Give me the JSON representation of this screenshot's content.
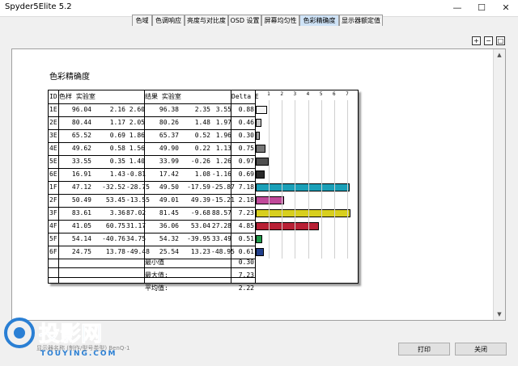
{
  "window": {
    "title": "Spyder5Elite 5.2",
    "minimize": "—",
    "maximize": "☐",
    "close": "✕"
  },
  "tabs": [
    {
      "label": "色域",
      "active": false
    },
    {
      "label": "色调响应",
      "active": false
    },
    {
      "label": "亮度与对比度",
      "active": false
    },
    {
      "label": "OSD 设置",
      "active": false
    },
    {
      "label": "屏幕均匀性",
      "active": false
    },
    {
      "label": "色彩精确度",
      "active": true
    },
    {
      "label": "显示器额定值",
      "active": false
    }
  ],
  "report": {
    "title": "色彩精确度",
    "headers": {
      "id": "ID",
      "sample": "色样 实验室",
      "result": "结果 实验室",
      "delta": "Delta E"
    },
    "rows": [
      {
        "id": "1E",
        "s": [
          "96.04",
          "2.16",
          "2.60"
        ],
        "r": [
          "96.38",
          "2.35",
          "3.55"
        ],
        "de": "0.88",
        "color": "#f4f4f4"
      },
      {
        "id": "2E",
        "s": [
          "80.44",
          "1.17",
          "2.05"
        ],
        "r": [
          "80.26",
          "1.48",
          "1.97"
        ],
        "de": "0.46",
        "color": "#c8c8c8"
      },
      {
        "id": "3E",
        "s": [
          "65.52",
          "0.69",
          "1.86"
        ],
        "r": [
          "65.37",
          "0.52",
          "1.96"
        ],
        "de": "0.30",
        "color": "#a0a0a0"
      },
      {
        "id": "4E",
        "s": [
          "49.62",
          "0.58",
          "1.56"
        ],
        "r": [
          "49.90",
          "0.22",
          "1.13"
        ],
        "de": "0.75",
        "color": "#777777"
      },
      {
        "id": "5E",
        "s": [
          "33.55",
          "0.35",
          "1.40"
        ],
        "r": [
          "33.99",
          "-0.26",
          "1.26"
        ],
        "de": "0.97",
        "color": "#4f4f4f"
      },
      {
        "id": "6E",
        "s": [
          "16.91",
          "1.43",
          "-0.81"
        ],
        "r": [
          "17.42",
          "1.08",
          "-1.16"
        ],
        "de": "0.69",
        "color": "#2a2a2a"
      },
      {
        "id": "1F",
        "s": [
          "47.12",
          "-32.52",
          "-28.75"
        ],
        "r": [
          "49.50",
          "-17.59",
          "-25.87"
        ],
        "de": "7.18",
        "color": "#1aa0b8"
      },
      {
        "id": "2F",
        "s": [
          "50.49",
          "53.45",
          "-13.55"
        ],
        "r": [
          "49.01",
          "49.39",
          "-15.21"
        ],
        "de": "2.18",
        "color": "#c04a9a"
      },
      {
        "id": "3F",
        "s": [
          "83.61",
          "3.36",
          "87.02"
        ],
        "r": [
          "81.45",
          "-9.68",
          "88.57"
        ],
        "de": "7.23",
        "color": "#d8cf1e"
      },
      {
        "id": "4F",
        "s": [
          "41.05",
          "60.75",
          "31.17"
        ],
        "r": [
          "36.06",
          "53.04",
          "27.28"
        ],
        "de": "4.85",
        "color": "#b82035"
      },
      {
        "id": "5F",
        "s": [
          "54.14",
          "-40.76",
          "34.75"
        ],
        "r": [
          "54.32",
          "-39.95",
          "33.49"
        ],
        "de": "0.51",
        "color": "#1f9a4a"
      },
      {
        "id": "6F",
        "s": [
          "24.75",
          "13.78",
          "-49.48"
        ],
        "r": [
          "25.54",
          "13.23",
          "-48.95"
        ],
        "de": "0.61",
        "color": "#213f8c"
      }
    ],
    "summary": [
      {
        "label": "最小值",
        "value": "0.30"
      },
      {
        "label": "最大值:",
        "value": "7.23"
      },
      {
        "label": "平均值:",
        "value": "2.22"
      }
    ]
  },
  "chart_data": {
    "type": "bar",
    "categories": [
      "1E",
      "2E",
      "3E",
      "4E",
      "5E",
      "6E",
      "1F",
      "2F",
      "3F",
      "4F",
      "5F",
      "6F"
    ],
    "values": [
      0.88,
      0.46,
      0.3,
      0.75,
      0.97,
      0.69,
      7.18,
      2.18,
      7.23,
      4.85,
      0.51,
      0.61
    ],
    "ticks": [
      "1",
      "2",
      "3",
      "4",
      "5",
      "6",
      "7"
    ],
    "xlim": [
      0,
      7.3
    ],
    "colors": [
      "#f4f4f4",
      "#c8c8c8",
      "#a0a0a0",
      "#777777",
      "#4f4f4f",
      "#2a2a2a",
      "#1aa0b8",
      "#c04a9a",
      "#d8cf1e",
      "#b82035",
      "#1f9a4a",
      "#213f8c"
    ],
    "grid": true
  },
  "status": "显示器名称 (制作/型号类型) BenQ-1",
  "buttons": {
    "print": "打印",
    "close": "关闭"
  },
  "watermark": {
    "brand": "投影网",
    "url": "TOUYING.COM"
  }
}
